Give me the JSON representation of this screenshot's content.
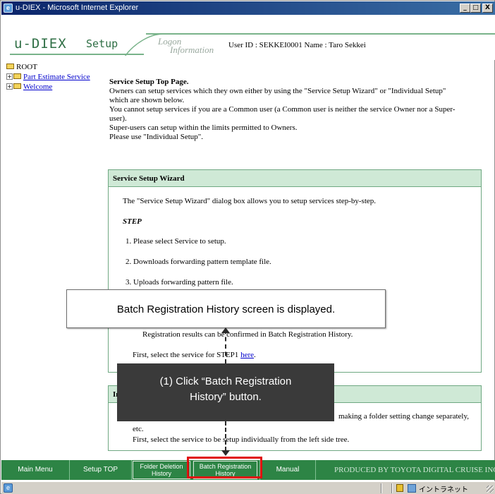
{
  "window": {
    "title": "u-DIEX - Microsoft Internet Explorer",
    "buttons": {
      "minimize": "_",
      "maximize": "□",
      "close": "X"
    }
  },
  "header": {
    "logo": "u-DIEX",
    "section": "Setup",
    "logon_line1": "Logon",
    "logon_line2": "Information",
    "user_info": "User ID : SEKKEI0001    Name : Taro Sekkei"
  },
  "tree": {
    "root": "ROOT",
    "items": [
      {
        "label": "Part Estimate Service"
      },
      {
        "label": "Welcome"
      }
    ]
  },
  "main": {
    "heading": "Service Setup Top Page.",
    "lines": [
      "Owners can setup services which they own either by using the \"Service Setup Wizard\" or \"Individual Setup\"",
      "which are shown below.",
      "You cannot setup services if you are a Common user (a Common user is neither the service Owner nor a Super-",
      "user).",
      "Super-users can setup within the limits permitted to Owners.",
      "Please use \"Individual Setup\"."
    ]
  },
  "wizard": {
    "title": "Service Setup Wizard",
    "intro": "The \"Service Setup Wizard\" dialog box allows you to setup services step-by-step.",
    "step_label": "STEP",
    "steps": [
      "1. Please select Service to setup.",
      "2. Downloads forwarding pattern template file.",
      "3. Uploads forwarding pattern file."
    ],
    "registration_note": "Registration results can be confirmed in Batch Registration History.",
    "first_select": "First, select the service for STEP1 ",
    "here_link": "here",
    "period": "."
  },
  "individual": {
    "title": "Individual Setup",
    "title_visible": "In",
    "line1_visible": "making a folder setting change separately,",
    "line2": "etc.",
    "line3": "First, select the service to be setup individually from the left side tree."
  },
  "callouts": {
    "result": "Batch Registration History screen is displayed.",
    "instruction_line1": "(1) Click “Batch Registration",
    "instruction_line2": "History” button."
  },
  "bottom_bar": {
    "main_menu": "Main Menu",
    "setup_top": "Setup TOP",
    "folder_deletion_1": "Folder Deletion",
    "folder_deletion_2": "History",
    "batch_reg_1": "Batch Registration",
    "batch_reg_2": "History",
    "manual": "Manual",
    "produced_by": "PRODUCED BY TOYOTA DIGITAL CRUISE INC."
  },
  "status_bar": {
    "zone": "イントラネット"
  },
  "colors": {
    "title_bar": "#0a246a",
    "brand_green": "#2f6f45",
    "panel_header": "#cfe9d6",
    "bottom_bar": "#2d8445",
    "highlight": "#e01010",
    "callout_dark": "#3a3a3a"
  },
  "icons": {
    "folder": "folder-icon",
    "expand": "plus-box-icon",
    "browser": "ie-icon",
    "lock": "lock-icon"
  }
}
